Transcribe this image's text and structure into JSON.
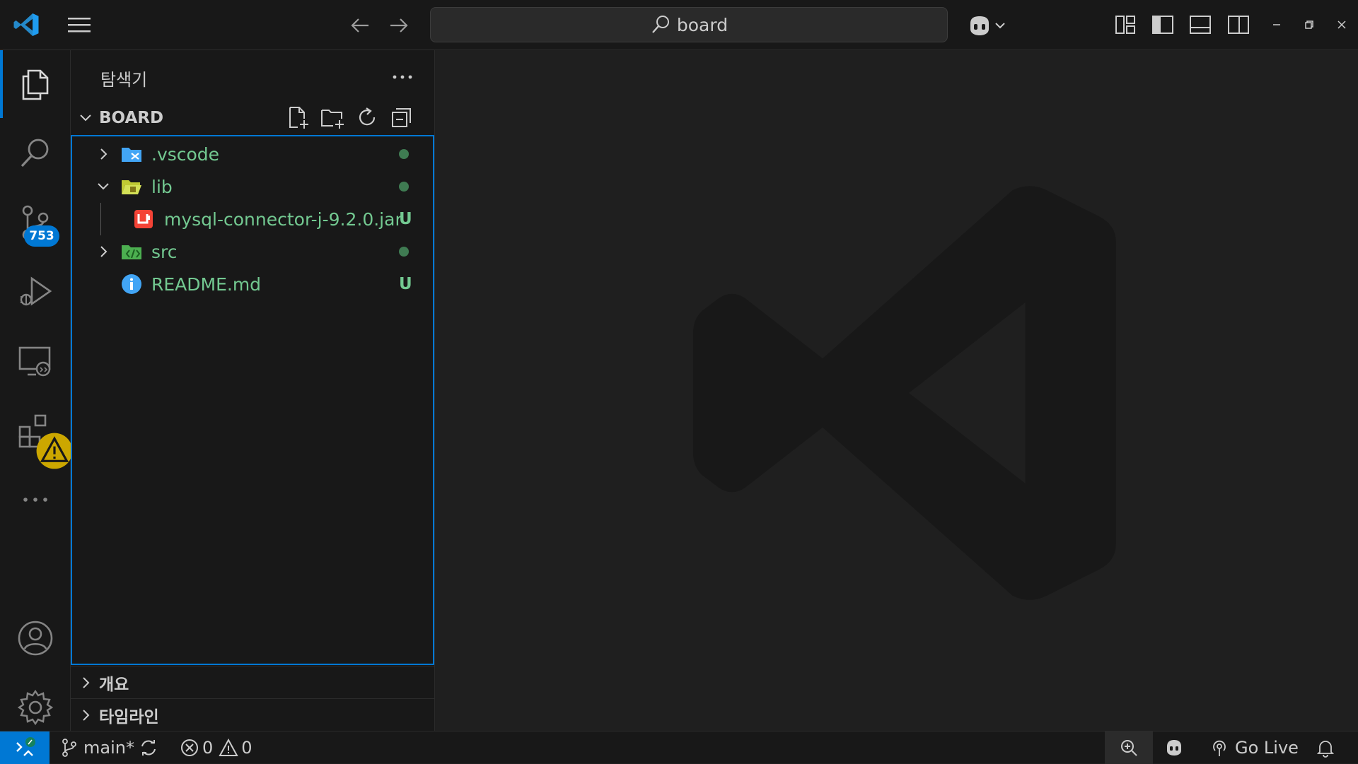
{
  "titlebar": {
    "search_text": "board"
  },
  "activitybar": {
    "scm_badge": "753"
  },
  "sidebar": {
    "title": "탐색기",
    "section_title": "BOARD",
    "tree": [
      {
        "name": ".vscode",
        "status": "dot"
      },
      {
        "name": "lib",
        "status": "dot"
      },
      {
        "name": "mysql-connector-j-9.2.0.jar",
        "status": "U"
      },
      {
        "name": "src",
        "status": "dot"
      },
      {
        "name": "README.md",
        "status": "U"
      }
    ],
    "outline_label": "개요",
    "timeline_label": "타임라인"
  },
  "statusbar": {
    "branch": "main*",
    "errors": "0",
    "warnings": "0",
    "go_live": "Go Live"
  },
  "colors": {
    "accent": "#0078d4",
    "git_untracked": "#73c991",
    "background": "#1f1f1f",
    "chrome": "#181818"
  }
}
